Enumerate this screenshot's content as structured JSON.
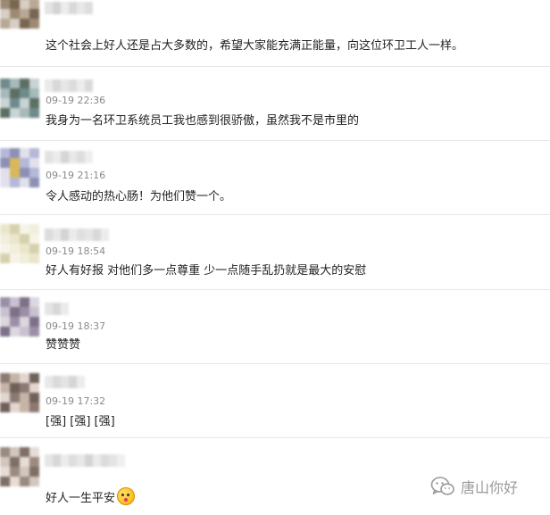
{
  "comments": [
    {
      "time": "",
      "text": "这个社会上好人还是占大多数的，希望大家能充满正能量，向这位环卫工人一样。",
      "avatar_colors": [
        "#7a6650",
        "#b8a894",
        "#9c8a74",
        "#d8cfc4"
      ]
    },
    {
      "time": "09-19 22:36",
      "text": "我身为一名环卫系统员工我也感到很骄傲，虽然我不是市里的",
      "avatar_colors": [
        "#6f8a8c",
        "#a7b9bb",
        "#5d6f62",
        "#c9d4d4"
      ]
    },
    {
      "time": "09-19 21:16",
      "text": "令人感动的热心肠！为他们赞一个。",
      "avatar_colors": [
        "#b5b8d8",
        "#d8b85a",
        "#8c90b4",
        "#e2e0ec"
      ]
    },
    {
      "time": "09-19 18:54",
      "text": "好人有好报 对他们多一点尊重 少一点随手乱扔就是最大的安慰",
      "avatar_colors": [
        "#e9e6cc",
        "#f1eedb",
        "#d6d1ad",
        "#f6f4e8"
      ]
    },
    {
      "time": "09-19 18:37",
      "text": "赞赞赞",
      "avatar_colors": [
        "#9a8fa6",
        "#c9c1d0",
        "#7d7088",
        "#dcd7e0"
      ]
    },
    {
      "time": "09-19 17:32",
      "text": "[强] [强] [强]",
      "avatar_colors": [
        "#8c7a72",
        "#c7b4a8",
        "#6f605a",
        "#e2d6ce"
      ]
    },
    {
      "time": "",
      "text": "好人一生平安",
      "avatar_colors": [
        "#9a8a80",
        "#d2c6bd",
        "#7e6f66",
        "#e6ddd6"
      ]
    }
  ],
  "watermark": {
    "label": "唐山你好",
    "icon": "wechat-icon"
  }
}
